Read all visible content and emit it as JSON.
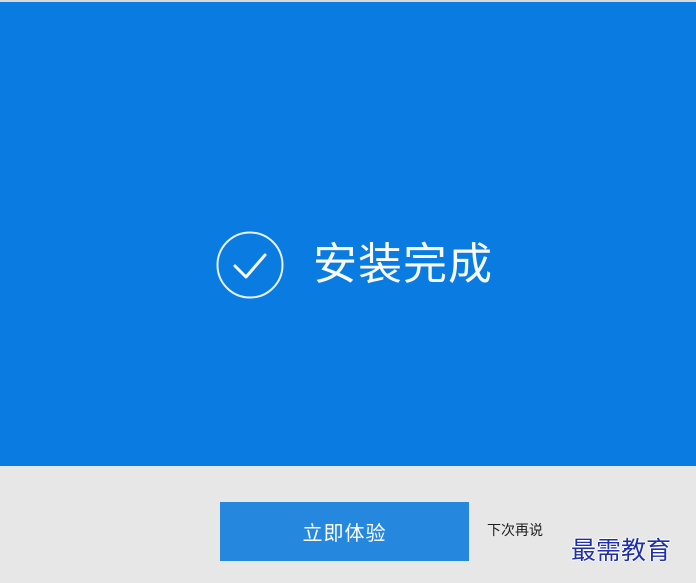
{
  "installer": {
    "status_title": "安装完成",
    "status_icon": "check-circle-icon",
    "primary_button_label": "立即体验",
    "later_label": "下次再说"
  },
  "watermark": {
    "text": "最需教育"
  },
  "colors": {
    "hero_background": "#0a7be0",
    "primary_button": "#2687de",
    "footer_background": "#e7e7e7",
    "watermark": "#1f2fa8"
  }
}
